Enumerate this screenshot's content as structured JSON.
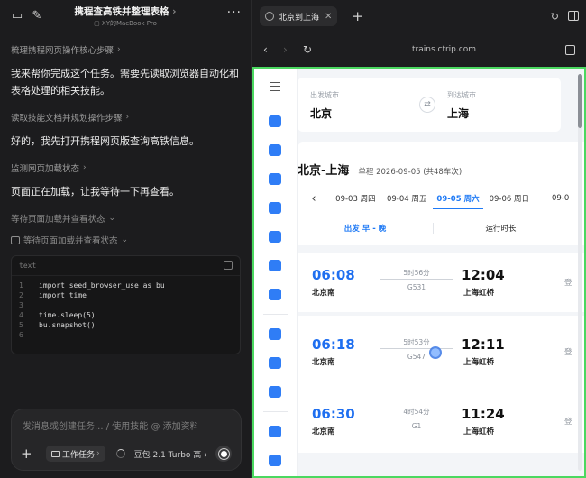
{
  "app": {
    "title": "携程查高铁并整理表格",
    "title_chevron": "›",
    "device": "XY的MacBook Pro",
    "more": "···"
  },
  "chat": {
    "steps": [
      {
        "label": "梳理携程网页操作核心步骤",
        "chev": "›"
      },
      {
        "label": "读取技能文档并规划操作步骤",
        "chev": "›"
      },
      {
        "label": "监测网页加载状态",
        "chev": "›"
      },
      {
        "label": "等待页面加载并查看状态",
        "chev": "⌄"
      },
      {
        "label": "等待页面加载并查看状态",
        "chev": "⌄"
      }
    ],
    "messages": [
      "我来帮你完成这个任务。需要先读取浏览器自动化和表格处理的相关技能。",
      "好的，我先打开携程网页版查询高铁信息。",
      "页面正在加载，让我等待一下再查看。"
    ],
    "code": {
      "lang": "text",
      "lines": [
        {
          "n": "1",
          "t": "import seed_browser_use as bu"
        },
        {
          "n": "2",
          "t": "import time"
        },
        {
          "n": "3",
          "t": ""
        },
        {
          "n": "4",
          "t": "time.sleep(5)"
        },
        {
          "n": "5",
          "t": "bu.snapshot()"
        },
        {
          "n": "6",
          "t": ""
        }
      ]
    }
  },
  "composer": {
    "placeholder": "发消息或创建任务... / 使用技能 @ 添加资料",
    "plus": "+",
    "chip": "工作任务",
    "chip_chev": "›",
    "model": "豆包 2.1 Turbo 高",
    "model_chev": "›"
  },
  "browser": {
    "tab_title": "北京到上海",
    "tab_close": "✕",
    "new_tab": "+",
    "url": "trains.ctrip.com",
    "back": "‹",
    "forward": "›",
    "reload": "↻"
  },
  "page": {
    "from_label": "出发城市",
    "from_city": "北京",
    "to_label": "到达城市",
    "to_city": "上海",
    "swap": "⇄",
    "route_title": "北京-上海",
    "route_sub": "单程 2026-09-05 (共48车次)",
    "date_prev": "‹",
    "dates": [
      {
        "label": "09-03 周四",
        "active": false
      },
      {
        "label": "09-04 周五",
        "active": false
      },
      {
        "label": "09-05 周六",
        "active": true
      },
      {
        "label": "09-06 周日",
        "active": false
      },
      {
        "label": "09-0",
        "active": false
      }
    ],
    "filter_depart": "出发 早 - 晚",
    "filter_duration": "运行时长",
    "trains": [
      {
        "dep": "06:08",
        "dep_st": "北京南",
        "dur": "5时56分",
        "no": "G531",
        "arr": "12:04",
        "arr_st": "上海虹桥",
        "book": "登"
      },
      {
        "dep": "06:18",
        "dep_st": "北京南",
        "dur": "5时53分",
        "no": "G547",
        "arr": "12:11",
        "arr_st": "上海虹桥",
        "book": "登"
      },
      {
        "dep": "06:30",
        "dep_st": "北京南",
        "dur": "4时54分",
        "no": "G1",
        "arr": "11:24",
        "arr_st": "上海虹桥",
        "book": "登"
      }
    ]
  },
  "colors": {
    "accent": "#1f7af5",
    "highlight_border": "#4bd860",
    "dark_bg": "#1c1c1e"
  }
}
